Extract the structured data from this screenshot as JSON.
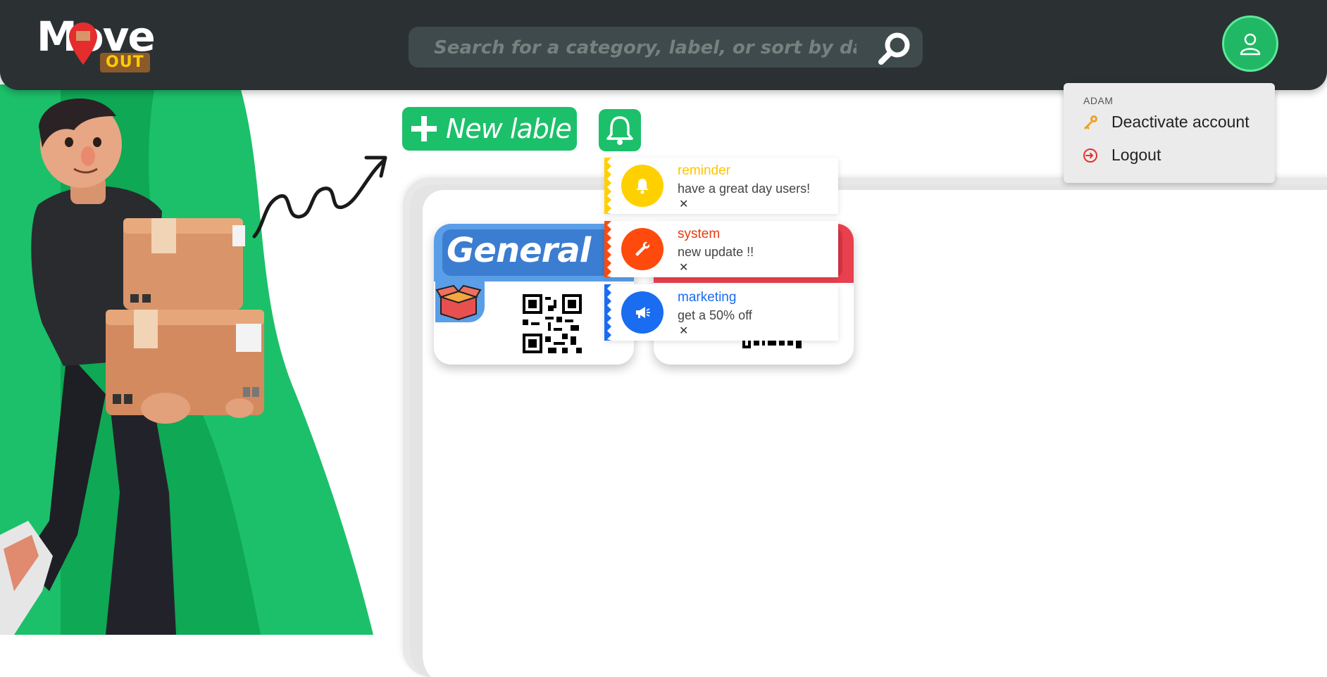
{
  "header": {
    "logo": {
      "text_main": "Move",
      "text_sub": "OUT"
    },
    "search": {
      "placeholder": "Search for a category, label, or sort by date ..."
    }
  },
  "toolbar": {
    "new_label": "New lable"
  },
  "cards": [
    {
      "title": "General",
      "color": "#3b7dd0"
    },
    {
      "title": "",
      "color": "#e8404f"
    }
  ],
  "notifications": [
    {
      "title": "reminder",
      "message": "have a great day users!",
      "close": "✕",
      "color": "#ffd000",
      "icon": "bell-icon"
    },
    {
      "title": "system",
      "message": "new update !!",
      "close": "✕",
      "color": "#ff4a0d",
      "icon": "wrench-icon"
    },
    {
      "title": "marketing",
      "message": "get a 50% off",
      "close": "✕",
      "color": "#1a6cf0",
      "icon": "megaphone-icon"
    }
  ],
  "account_menu": {
    "username": "ADAM",
    "items": [
      {
        "label": "Deactivate account",
        "icon": "key-icon"
      },
      {
        "label": "Logout",
        "icon": "logout-icon"
      }
    ]
  },
  "colors": {
    "header_bg": "#2b3133",
    "accent_green": "#1cc06a"
  }
}
